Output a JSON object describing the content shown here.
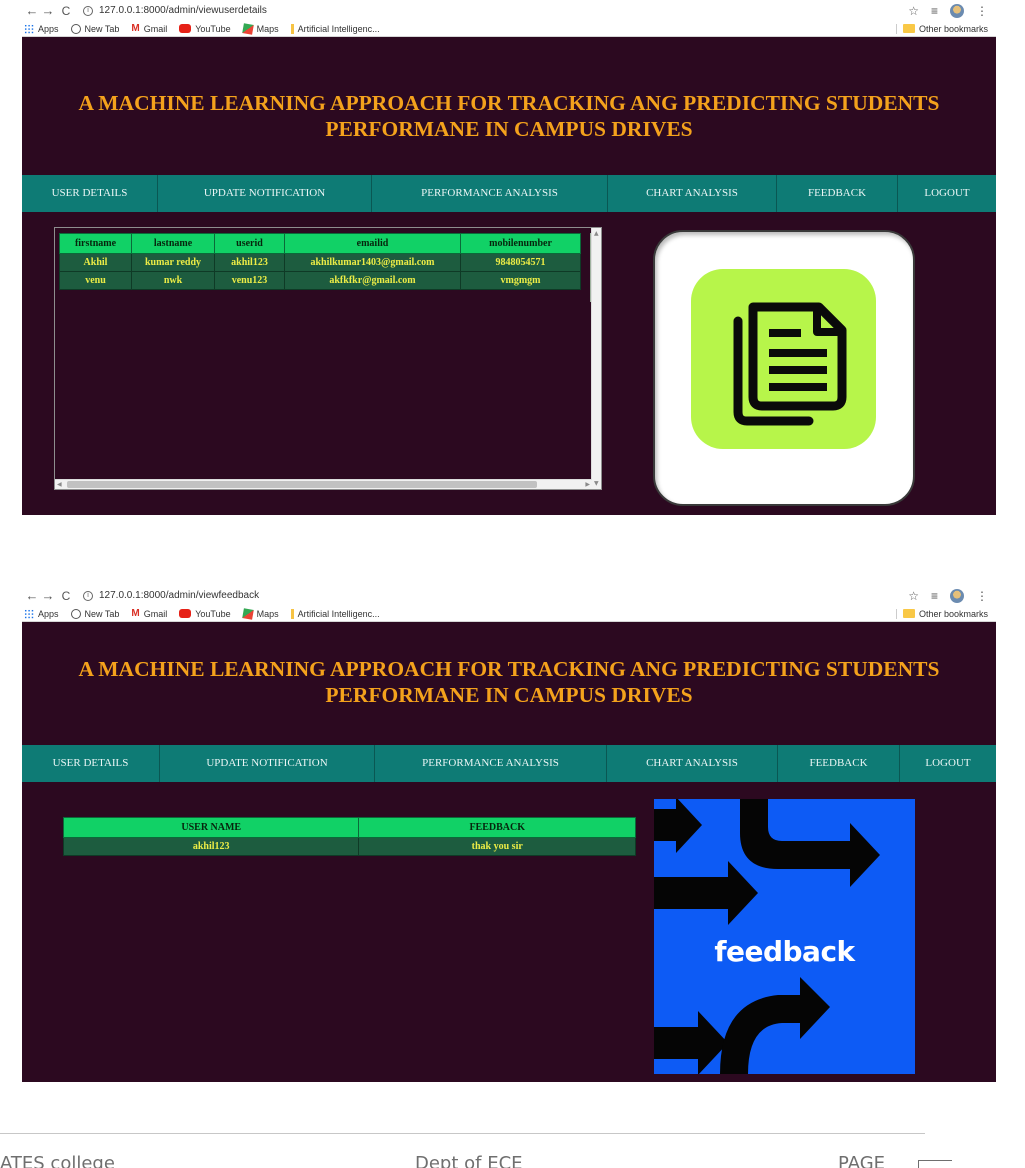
{
  "browser": {
    "bookmarks": [
      "Apps",
      "New Tab",
      "Gmail",
      "YouTube",
      "Maps",
      "Artificial Intelligenc..."
    ],
    "other_bookmarks": "Other bookmarks"
  },
  "site": {
    "title_line1": "A MACHINE LEARNING APPROACH FOR TRACKING ANG PREDICTING STUDENTS",
    "title_line2": "PERFORMANE IN CAMPUS DRIVES",
    "nav": [
      "USER DETAILS",
      "UPDATE NOTIFICATION",
      "PERFORMANCE ANALYSIS",
      "CHART ANALYSIS",
      "FEEDBACK",
      "LOGOUT"
    ],
    "colors": {
      "background": "#2c0920",
      "title": "#f4a21c",
      "nav": "#0e7b75",
      "table_header": "#11d166",
      "table_cell": "#1d5c3f",
      "cell_text": "#ecec46"
    }
  },
  "screen1": {
    "url": "127.0.0.1:8000/admin/viewuserdetails",
    "table": {
      "headers": [
        "firstname",
        "lastname",
        "userid",
        "emailid",
        "mobilenumber"
      ],
      "rows": [
        [
          "Akhil",
          "kumar reddy",
          "akhil123",
          "akhilkumar1403@gmail.com",
          "9848054571"
        ],
        [
          "venu",
          "nwk",
          "venu123",
          "akfkfkr@gmail.com",
          "vmgmgm"
        ]
      ]
    },
    "image_icon": "document-copy-icon"
  },
  "screen2": {
    "url": "127.0.0.1:8000/admin/viewfeedback",
    "table": {
      "headers": [
        "USER NAME",
        "FEEDBACK"
      ],
      "rows": [
        [
          "akhil123",
          "thak you sir"
        ]
      ]
    },
    "image_text": "feedback"
  },
  "footer": {
    "left": "ATES college",
    "center": "Dept of ECE",
    "right": "PAGE"
  }
}
